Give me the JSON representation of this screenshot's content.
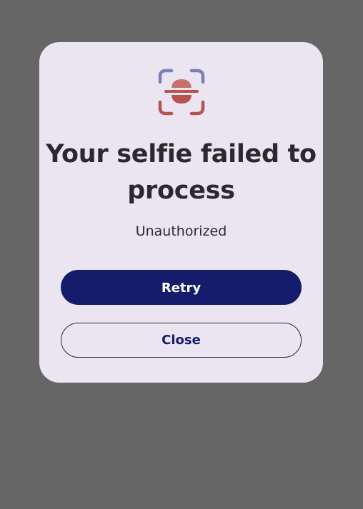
{
  "dialog": {
    "icon": "selfie-scan-icon",
    "title": "Your selfie failed to process",
    "message": "Unauthorized",
    "retry_label": "Retry",
    "close_label": "Close"
  },
  "colors": {
    "scrim": "#666666",
    "dialog_background": "#EAE5F0",
    "primary": "#141C6B",
    "text": "#2B2930",
    "icon_frame_top": "#7C7FB8",
    "icon_error": "#B5544F"
  }
}
